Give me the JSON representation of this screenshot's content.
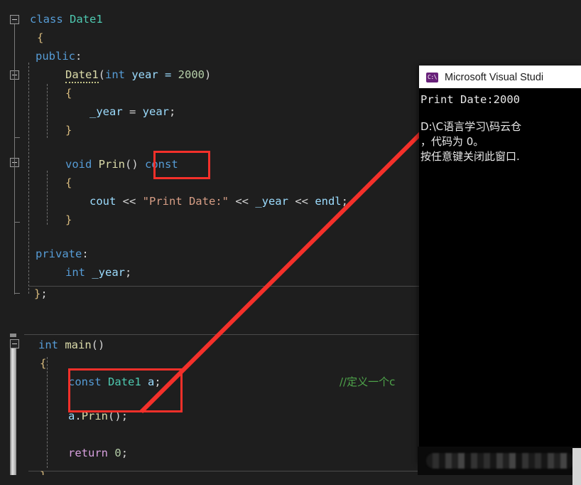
{
  "editor": {
    "background": "#1e1e1e",
    "colors": {
      "keyword": "#569cd6",
      "type": "#4ec9b0",
      "function": "#dcdcaa",
      "string": "#d69d85",
      "number": "#b5cea8",
      "identifier": "#9cdcfe",
      "comment": "#4ea34a",
      "control": "#d8a0df",
      "brace": "#d7ba7d",
      "highlight_box": "#f4302a",
      "arrow": "#f4302a"
    },
    "lines": [
      {
        "indent": 0,
        "tokens": [
          {
            "t": "class ",
            "c": "kw"
          },
          {
            "t": "Date1",
            "c": "type"
          }
        ]
      },
      {
        "indent": 1,
        "tokens": [
          {
            "t": "{",
            "c": "brace"
          }
        ]
      },
      {
        "indent": 1,
        "tokens": [
          {
            "t": "public",
            "c": "kw"
          },
          {
            "t": ":",
            "c": "punct"
          }
        ]
      },
      {
        "indent": 2,
        "tokens": [
          {
            "t": "Date1",
            "c": "fn squiggle"
          },
          {
            "t": "(",
            "c": "punct"
          },
          {
            "t": "int",
            "c": "kw"
          },
          {
            "t": " year = ",
            "c": "ident"
          },
          {
            "t": "2000",
            "c": "num"
          },
          {
            "t": ")",
            "c": "punct"
          }
        ]
      },
      {
        "indent": 2,
        "tokens": [
          {
            "t": "{",
            "c": "brace"
          }
        ]
      },
      {
        "indent": 3,
        "tokens": [
          {
            "t": "_year",
            "c": "ident"
          },
          {
            "t": " = ",
            "c": "plain"
          },
          {
            "t": "year",
            "c": "ident"
          },
          {
            "t": ";",
            "c": "punct"
          }
        ]
      },
      {
        "indent": 2,
        "tokens": [
          {
            "t": "}",
            "c": "brace"
          }
        ]
      },
      {
        "indent": 0,
        "tokens": []
      },
      {
        "indent": 2,
        "tokens": [
          {
            "t": "void",
            "c": "kw"
          },
          {
            "t": " ",
            "c": "plain"
          },
          {
            "t": "Prin",
            "c": "fn"
          },
          {
            "t": "()",
            "c": "punct"
          },
          {
            "t": " ",
            "c": "plain"
          },
          {
            "t": "const",
            "c": "kw"
          }
        ]
      },
      {
        "indent": 2,
        "tokens": [
          {
            "t": "{",
            "c": "brace"
          }
        ]
      },
      {
        "indent": 3,
        "tokens": [
          {
            "t": "cout",
            "c": "ident"
          },
          {
            "t": " << ",
            "c": "plain"
          },
          {
            "t": "\"Print Date:\"",
            "c": "str"
          },
          {
            "t": " << ",
            "c": "plain"
          },
          {
            "t": "_year",
            "c": "ident"
          },
          {
            "t": " << ",
            "c": "plain"
          },
          {
            "t": "endl",
            "c": "ident"
          },
          {
            "t": ";",
            "c": "punct"
          }
        ]
      },
      {
        "indent": 2,
        "tokens": [
          {
            "t": "}",
            "c": "brace"
          }
        ]
      },
      {
        "indent": 0,
        "tokens": []
      },
      {
        "indent": 1,
        "tokens": [
          {
            "t": "private",
            "c": "kw"
          },
          {
            "t": ":",
            "c": "punct"
          }
        ]
      },
      {
        "indent": 2,
        "tokens": [
          {
            "t": "int",
            "c": "kw"
          },
          {
            "t": " _year",
            "c": "ident"
          },
          {
            "t": ";",
            "c": "punct"
          }
        ]
      },
      {
        "indent": 1,
        "tokens": [
          {
            "t": "}",
            "c": "brace"
          },
          {
            "t": ";",
            "c": "punct"
          }
        ]
      }
    ],
    "main_lines": [
      {
        "indent": 0,
        "tokens": [
          {
            "t": "int",
            "c": "kw"
          },
          {
            "t": " ",
            "c": "plain"
          },
          {
            "t": "main",
            "c": "fn"
          },
          {
            "t": "()",
            "c": "punct"
          }
        ]
      },
      {
        "indent": 1,
        "tokens": [
          {
            "t": "{",
            "c": "brace"
          }
        ]
      },
      {
        "indent": 2,
        "tokens": [
          {
            "t": "const",
            "c": "kw"
          },
          {
            "t": " ",
            "c": "plain"
          },
          {
            "t": "Date1",
            "c": "type"
          },
          {
            "t": " ",
            "c": "plain"
          },
          {
            "t": "a",
            "c": "ident"
          },
          {
            "t": ";",
            "c": "punct"
          }
        ]
      },
      {
        "indent": 2,
        "tokens": [
          {
            "t": "a",
            "c": "ident"
          },
          {
            "t": ".",
            "c": "punct"
          },
          {
            "t": "Prin",
            "c": "fn"
          },
          {
            "t": "()",
            "c": "punct"
          },
          {
            "t": ";",
            "c": "punct"
          }
        ]
      },
      {
        "indent": 0,
        "tokens": []
      },
      {
        "indent": 2,
        "tokens": [
          {
            "t": "return",
            "c": "ctrl"
          },
          {
            "t": " ",
            "c": "plain"
          },
          {
            "t": "0",
            "c": "num"
          },
          {
            "t": ";",
            "c": "punct"
          }
        ]
      },
      {
        "indent": 1,
        "tokens": [
          {
            "t": "}",
            "c": "brace"
          }
        ]
      }
    ],
    "comment": "//定义一个c"
  },
  "console": {
    "title": "Microsoft Visual Studi",
    "icon": "console-app-icon",
    "output_line": "Print Date:2000",
    "path_line": "D:\\C语言学习\\码云仓",
    "exit_line": "，代码为 0。",
    "press_key_line": "按任意键关闭此窗口."
  },
  "annotations": {
    "boxes": [
      {
        "name": "const-qualifier-box",
        "label": "const"
      },
      {
        "name": "const-object-decl-box",
        "label": "const Date1 a;"
      }
    ],
    "arrow": {
      "name": "callout-arrow",
      "from_label": "const Date1 a;",
      "to_label": "Print Date:2000",
      "color": "#f4302a"
    }
  }
}
